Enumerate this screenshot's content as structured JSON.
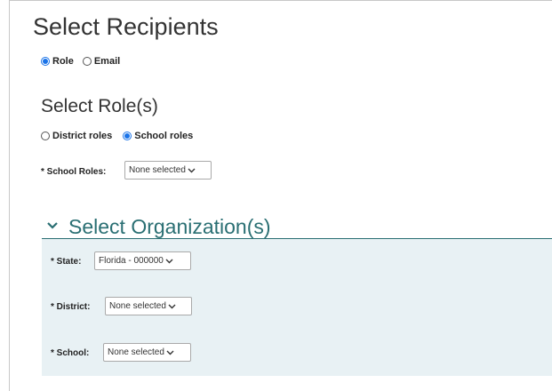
{
  "recipients": {
    "title": "Select Recipients",
    "options": [
      {
        "label": "Role",
        "checked": true
      },
      {
        "label": "Email",
        "checked": false
      }
    ]
  },
  "roles": {
    "title": "Select Role(s)",
    "options": [
      {
        "label": "District roles",
        "checked": false
      },
      {
        "label": "School roles",
        "checked": true
      }
    ],
    "school_roles_label": "* School Roles:",
    "school_roles_value": "None selected"
  },
  "organization": {
    "title": "Select Organization(s)",
    "state_label": "* State:",
    "state_value": "Florida - 000000",
    "district_label": "* District:",
    "district_value": "None selected",
    "school_label": "* School:",
    "school_value": "None selected"
  },
  "colors": {
    "accent": "#1a73e8",
    "section_title": "#2a6f73",
    "panel_bg": "#e8f1f4"
  }
}
